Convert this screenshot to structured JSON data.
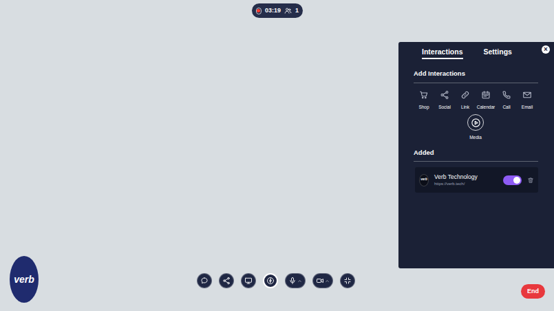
{
  "call": {
    "recording": true,
    "timer": "03:19",
    "participants": "1"
  },
  "logo": "verb",
  "panel": {
    "tabs": [
      {
        "label": "Interactions",
        "selected": true
      },
      {
        "label": "Settings",
        "selected": false
      }
    ],
    "close": "×",
    "add_heading": "Add Interactions",
    "interactions": [
      {
        "label": "Shop",
        "kind": "shop",
        "selected": false
      },
      {
        "label": "Social",
        "kind": "social",
        "selected": false
      },
      {
        "label": "Link",
        "kind": "link",
        "selected": false
      },
      {
        "label": "Calendar",
        "kind": "calendar",
        "selected": false
      },
      {
        "label": "Call",
        "kind": "call",
        "selected": false
      },
      {
        "label": "Email",
        "kind": "email",
        "selected": false
      },
      {
        "label": "Media",
        "kind": "media",
        "selected": true
      }
    ],
    "added_heading": "Added",
    "added": [
      {
        "logo": "verb",
        "name": "Verb Technology",
        "url": "https://verb.tech/",
        "on": true
      }
    ]
  },
  "toolbar": {
    "buttons": [
      {
        "kind": "chat",
        "selected": false
      },
      {
        "kind": "share",
        "selected": false
      },
      {
        "kind": "screen",
        "selected": false
      },
      {
        "kind": "bolt",
        "selected": true
      },
      {
        "kind": "mic",
        "selected": false
      },
      {
        "kind": "camera",
        "selected": false
      },
      {
        "kind": "collapse",
        "selected": false
      }
    ],
    "end": "End"
  }
}
